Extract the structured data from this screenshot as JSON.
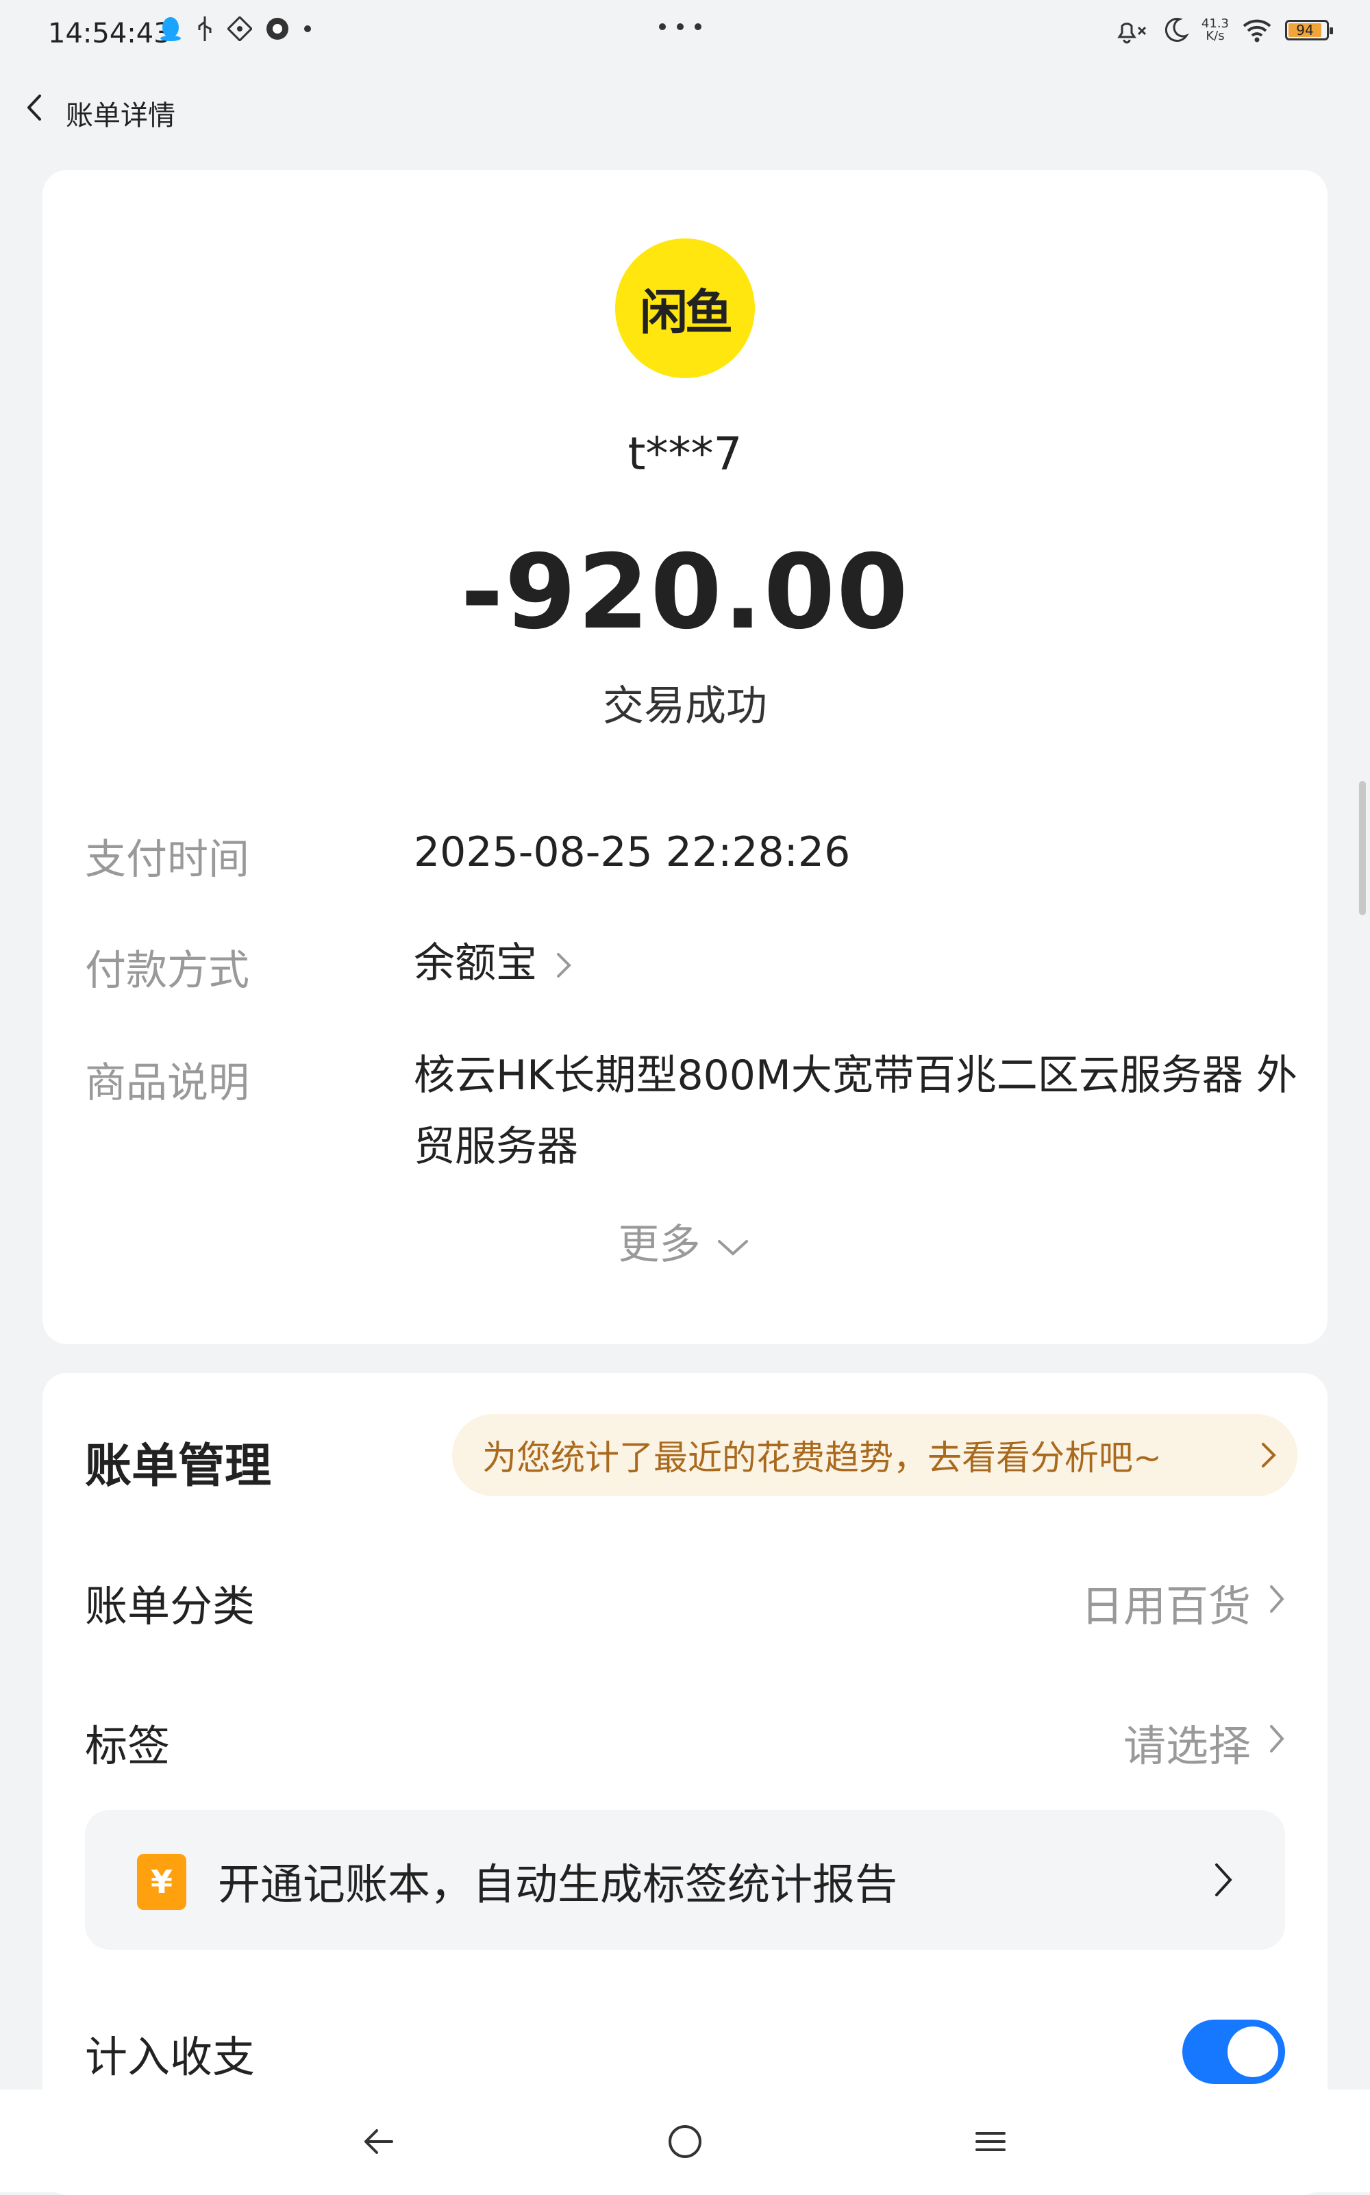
{
  "status_bar": {
    "time": "14:54:43",
    "net_speed_value": "41.3",
    "net_speed_unit": "K/s",
    "battery": "94",
    "icons": [
      "qq-icon",
      "usb-icon",
      "sim-icon",
      "app-icon",
      "dot-icon",
      "mute-bell-icon",
      "moon-icon",
      "wifi-icon",
      "battery-icon"
    ]
  },
  "nav": {
    "title": "账单详情"
  },
  "transaction": {
    "merchant_logo": "闲鱼",
    "merchant": "t***7",
    "amount": "-920.00",
    "status": "交易成功",
    "details": [
      {
        "label": "支付时间",
        "value": "2025-08-25 22:28:26"
      },
      {
        "label": "付款方式",
        "value": "余额宝"
      },
      {
        "label": "商品说明",
        "value": "核云HK长期型800M大宽带百兆二区云服务器 外贸服务器"
      }
    ],
    "more_label": "更多"
  },
  "bill_management": {
    "title": "账单管理",
    "promo": "为您统计了最近的花费趋势，去看看分析吧~",
    "category_label": "账单分类",
    "category_value": "日用百货",
    "tag_label": "标签",
    "tag_value": "请选择",
    "notebook_icon": "¥",
    "notebook_text": "开通记账本，自动生成标签统计报告",
    "income_label": "计入收支",
    "income_toggle": true
  },
  "colors": {
    "accent": "#1677ff",
    "logo_yellow": "#ffe60f",
    "promo_text": "#a96a1e",
    "promo_bg": "#fbf3e4",
    "notebook_icon": "#ffa10e"
  }
}
